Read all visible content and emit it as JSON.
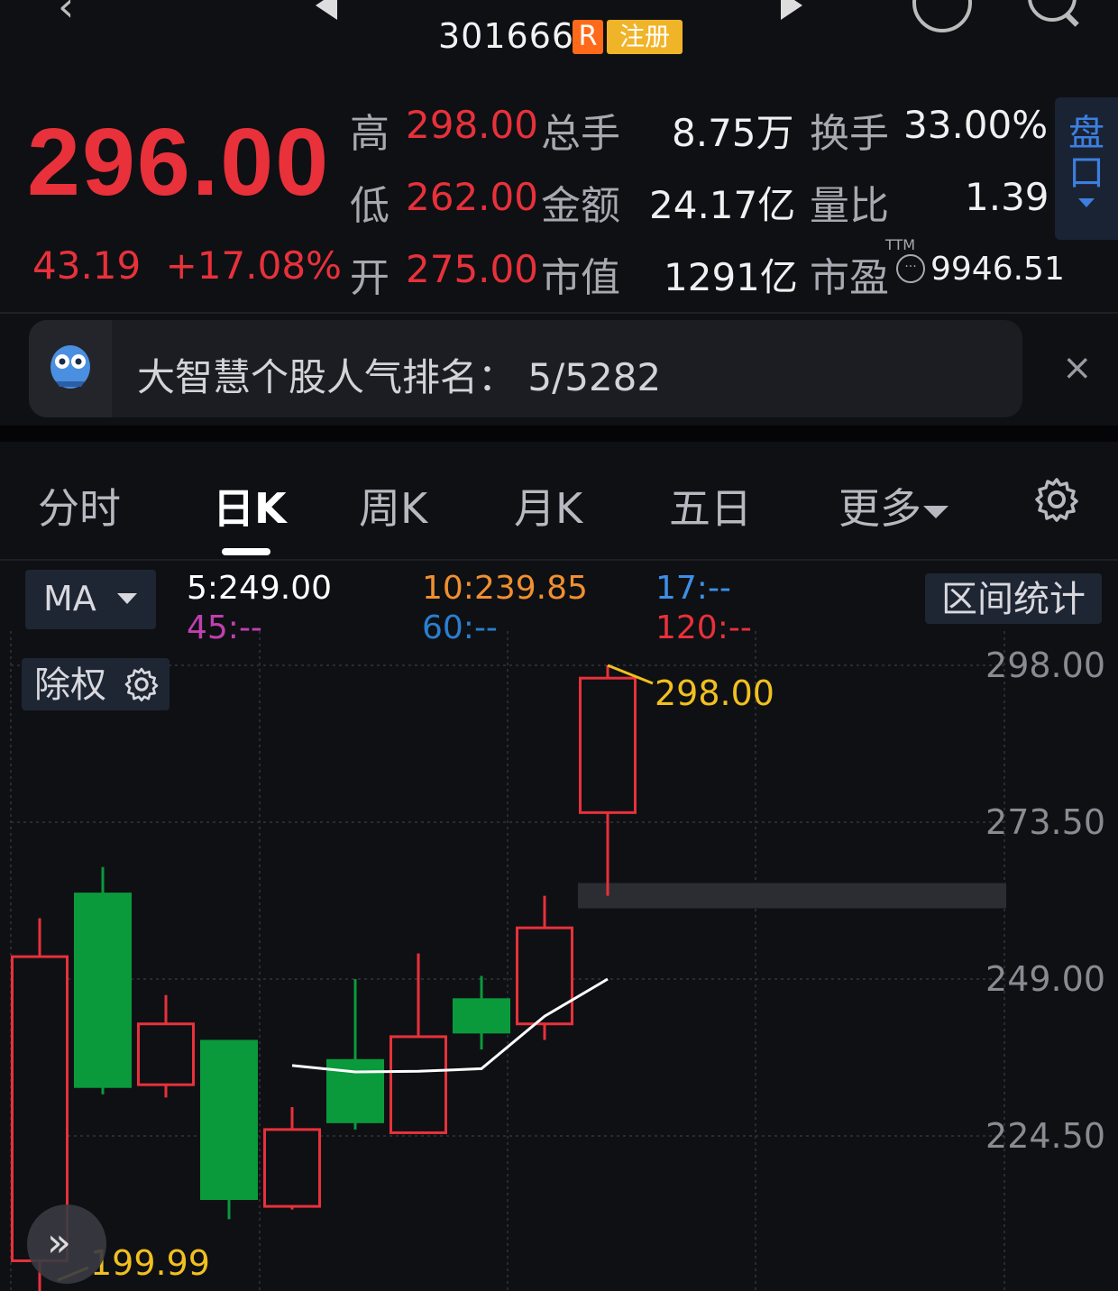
{
  "header": {
    "code": "301666",
    "tag_r": "R",
    "tag_reg": "注册"
  },
  "quote": {
    "price": "296.00",
    "change": "43.19",
    "change_pct": "+17.08%",
    "rows": [
      {
        "l1": "高",
        "v1": "298.00",
        "l2": "总手",
        "v2": "8.75万",
        "l3": "换手",
        "v3": "33.00%"
      },
      {
        "l1": "低",
        "v1": "262.00",
        "l2": "金额",
        "v2": "24.17亿",
        "l3": "量比",
        "v3": "1.39"
      },
      {
        "l1": "开",
        "v1": "275.00",
        "l2": "市值",
        "v2": "1291亿",
        "l3": "市盈",
        "v3": "9946.51"
      }
    ],
    "ttm": "TTM",
    "pankou": [
      "盘",
      "口"
    ]
  },
  "banner": {
    "text": "大智慧个股人气排名：  5/5282",
    "close": "×"
  },
  "tabs": {
    "items": [
      "分时",
      "日K",
      "周K",
      "月K",
      "五日",
      "更多"
    ]
  },
  "indicators": {
    "ma_button": "MA",
    "ma5": "5:249.00",
    "ma10": "10:239.85",
    "ma17": "17:--",
    "ma45": "45:--",
    "ma60": "60:--",
    "ma120": "120:--",
    "range_stats": "区间统计",
    "adjust": "除权"
  },
  "colors": {
    "up": "#e8313a",
    "down": "#0a9a3c",
    "ma5": "#ffffff",
    "ma10": "#f09030",
    "ma17": "#3d8fe8",
    "ma45": "#c040b0",
    "ma60": "#2a7fd0",
    "ma120": "#e8313a",
    "highlight": "#f0c020"
  },
  "chart_data": {
    "type": "candlestick",
    "y_ticks": [
      "298.00",
      "273.50",
      "249.00",
      "224.50"
    ],
    "ylim": [
      199.99,
      298.0
    ],
    "high_label": "298.00",
    "low_label": "199.99",
    "candles": [
      {
        "open": 205.0,
        "close": 252.5,
        "high": 258.5,
        "low": 199.99
      },
      {
        "open": 262.5,
        "close": 232.0,
        "high": 266.5,
        "low": 231.0
      },
      {
        "open": 232.5,
        "close": 242.0,
        "high": 246.5,
        "low": 230.5
      },
      {
        "open": 239.5,
        "close": 214.5,
        "high": 239.5,
        "low": 211.5
      },
      {
        "open": 213.5,
        "close": 225.5,
        "high": 229.0,
        "low": 213.0
      },
      {
        "open": 236.5,
        "close": 226.5,
        "high": 249.0,
        "low": 225.5
      },
      {
        "open": 225.0,
        "close": 240.0,
        "high": 253.0,
        "low": 225.0
      },
      {
        "open": 246.0,
        "close": 240.5,
        "high": 249.5,
        "low": 238.0
      },
      {
        "open": 242.0,
        "close": 257.0,
        "high": 262.0,
        "low": 239.5
      },
      {
        "open": 275.0,
        "close": 296.0,
        "high": 298.0,
        "low": 262.0
      }
    ],
    "ma5": [
      null,
      null,
      null,
      null,
      235.5,
      234.5,
      234.6,
      235.0,
      243.2,
      249.0
    ],
    "grid": true
  }
}
